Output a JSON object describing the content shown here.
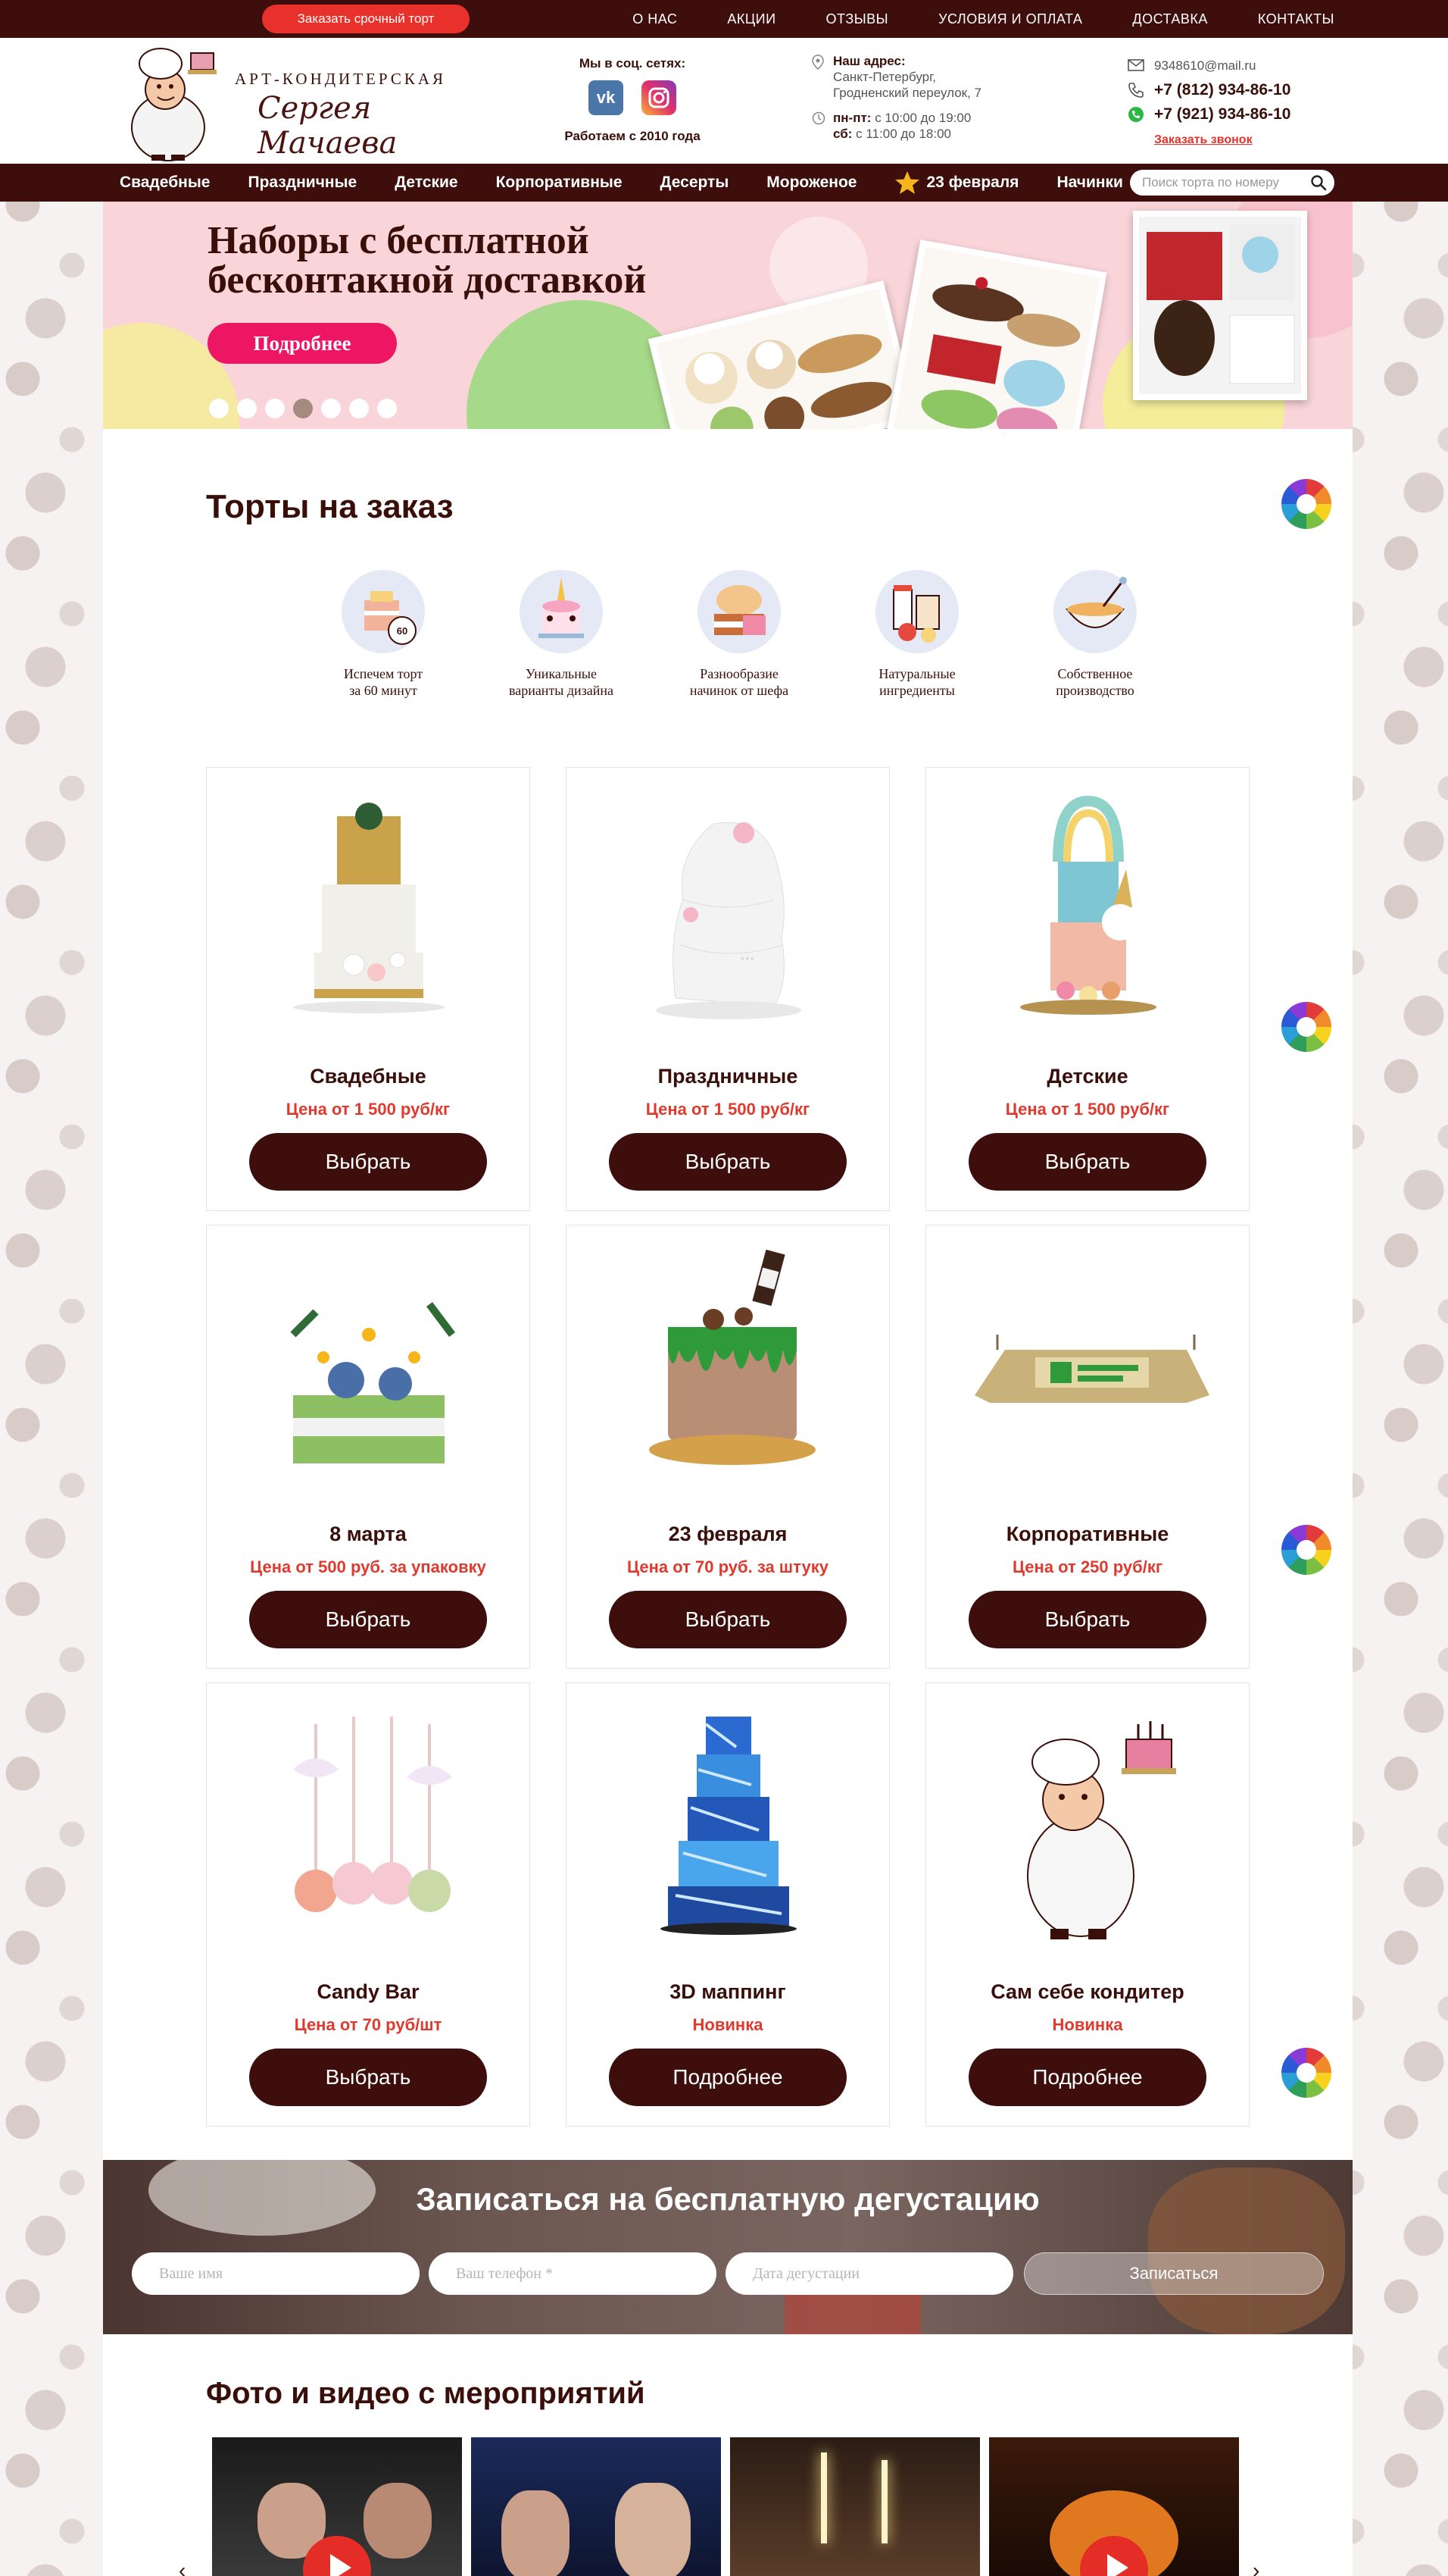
{
  "topbar": {
    "urgent_button": "Заказать срочный торт",
    "nav": [
      "О НАС",
      "АКЦИИ",
      "ОТЗЫВЫ",
      "УСЛОВИЯ И ОПЛАТА",
      "ДОСТАВКА",
      "КОНТАКТЫ"
    ]
  },
  "header": {
    "logo_line1": "АРТ-КОНДИТЕРСКАЯ",
    "logo_line2": "Сергея Мачаева",
    "social_title": "Мы в соц. сетях:",
    "vk_label": "vk",
    "since": "Работаем с 2010 года",
    "address_title": "Наш адрес:",
    "address_line1": "Санкт-Петербург,",
    "address_line2": "Гродненский переулок, 7",
    "hours_weekdays_label": "пн-пт:",
    "hours_weekdays": "с 10:00 до 19:00",
    "hours_sat_label": "сб:",
    "hours_sat": "с 11:00 до 18:00",
    "email": "9348610@mail.ru",
    "phone1": "+7 (812) 934-86-10",
    "phone2": "+7 (921) 934-86-10",
    "callback": "Заказать звонок"
  },
  "catnav": {
    "items": [
      "Свадебные",
      "Праздничные",
      "Детские",
      "Корпоративные",
      "Десерты",
      "Мороженое",
      "23 февраля",
      "Начинки"
    ],
    "search_placeholder": "Поиск торта по номеру"
  },
  "banner": {
    "title_line1": "Наборы с бесплатной",
    "title_line2": "бесконтакной доставкой",
    "button": "Подробнее",
    "slides": 7,
    "active_slide": 4
  },
  "cakes_section": {
    "title": "Торты на заказ",
    "features": [
      {
        "line1": "Испечем торт",
        "line2": "за 60 минут",
        "icon": "clock-cake-icon",
        "badge": "60"
      },
      {
        "line1": "Уникальные",
        "line2": "варианты дизайна",
        "icon": "unicorn-cake-icon"
      },
      {
        "line1": "Разнообразие",
        "line2": "начинок от шефа",
        "icon": "cake-layers-icon"
      },
      {
        "line1": "Натуральные",
        "line2": "ингредиенты",
        "icon": "ingredients-icon"
      },
      {
        "line1": "Собственное",
        "line2": "производство",
        "icon": "mixing-bowl-icon"
      }
    ],
    "cards": [
      {
        "title": "Свадебные",
        "price": "Цена от 1 500 руб/кг",
        "button": "Выбрать",
        "image": "wedding-cake"
      },
      {
        "title": "Праздничные",
        "price": "Цена от 1 500 руб/кг",
        "button": "Выбрать",
        "image": "holiday-cake"
      },
      {
        "title": "Детские",
        "price": "Цена от 1 500 руб/кг",
        "button": "Выбрать",
        "image": "kids-cake"
      },
      {
        "title": "8 марта",
        "price": "Цена от 500 руб. за упаковку",
        "button": "Выбрать",
        "image": "flower-cake"
      },
      {
        "title": "23 февраля",
        "price": "Цена от 70 руб. за штуку",
        "button": "Выбрать",
        "image": "drip-cake"
      },
      {
        "title": "Корпоративные",
        "price": "Цена от 250 руб/кг",
        "button": "Выбрать",
        "image": "corporate-cake"
      },
      {
        "title": "Candy Bar",
        "price": "Цена от 70 руб/шт",
        "button": "Выбрать",
        "image": "cake-pops"
      },
      {
        "title": "3D маппинг",
        "price": "Новинка",
        "button": "Подробнее",
        "image": "mapping-cake"
      },
      {
        "title": "Сам себе кондитер",
        "price": "Новинка",
        "button": "Подробнее",
        "image": "chef-mascot"
      }
    ]
  },
  "tasting": {
    "title": "Записаться на бесплатную дегустацию",
    "name_placeholder": "Ваше имя",
    "phone_placeholder": "Ваш телефон *",
    "date_placeholder": "Дата дегустации",
    "submit": "Записаться"
  },
  "media_section": {
    "title": "Фото и видео с мероприятий",
    "arrow_prev": "‹",
    "arrow_next": "›"
  },
  "colors": {
    "brand_dark": "#3d0e0b",
    "accent_red": "#e8312a",
    "price_red": "#e03a2e",
    "banner_pink": "#f9d4d9",
    "banner_button": "#ec1663"
  }
}
